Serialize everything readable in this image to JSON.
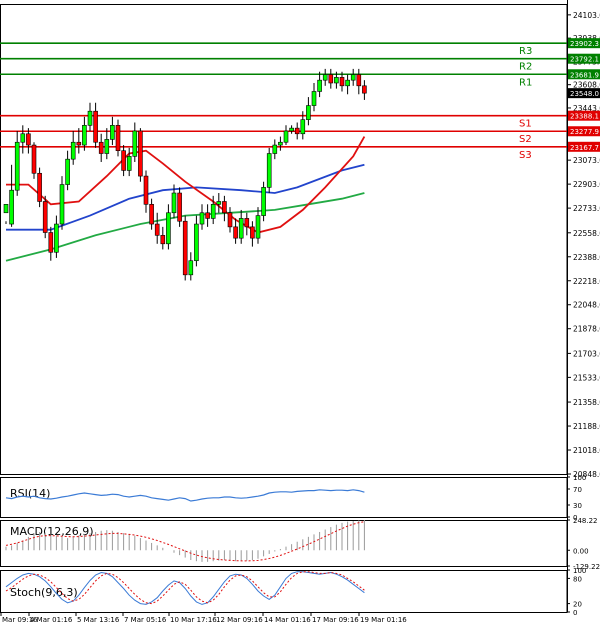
{
  "chart_data": [
    {
      "type": "candlestick",
      "panel": "price",
      "y_ticks": [
        "24103.0",
        "23938.0",
        "23773.0",
        "23608.0",
        "23443.0",
        "23278.0",
        "23073.0",
        "22903.0",
        "22733.0",
        "22558.0",
        "22388.0",
        "22218.0",
        "22048.0",
        "21878.0",
        "21703.0",
        "21533.0",
        "21358.0",
        "21188.0",
        "21018.0",
        "20848.0"
      ],
      "x_ticks": [
        "Mar 09:16",
        "4 Mar 01:16",
        "5 Mar 13:16",
        "7 Mar 05:16",
        "10 Mar 17:16",
        "12 Mar 09:16",
        "14 Mar 01:16",
        "17 Mar 09:16",
        "19 Mar 01:16"
      ],
      "ylim": [
        20848,
        24180
      ],
      "levels": [
        {
          "name": "R3",
          "value": 23902.3,
          "label": "23902.3",
          "color": "#008000"
        },
        {
          "name": "R2",
          "value": 23792.1,
          "label": "23792.1",
          "color": "#008000"
        },
        {
          "name": "R1",
          "value": 23681.9,
          "label": "23681.9",
          "color": "#008000"
        },
        {
          "name": "S1",
          "value": 23388.1,
          "label": "23388.1",
          "color": "#e00000"
        },
        {
          "name": "S2",
          "value": 23277.9,
          "label": "23277.9",
          "color": "#e00000"
        },
        {
          "name": "S3",
          "value": 23167.7,
          "label": "23167.7",
          "color": "#e00000"
        }
      ],
      "current_price": {
        "value": 23548.0,
        "label": "23548.0"
      },
      "candles": [
        [
          22700,
          22760,
          22640,
          22620
        ],
        [
          22620,
          22860,
          23040,
          22600
        ],
        [
          22860,
          23200,
          23280,
          22820
        ],
        [
          23200,
          23260,
          23320,
          23120
        ],
        [
          23260,
          23180,
          23300,
          23120
        ],
        [
          23180,
          22980,
          23200,
          22940
        ],
        [
          22980,
          22780,
          23020,
          22740
        ],
        [
          22780,
          22560,
          22820,
          22520
        ],
        [
          22560,
          22420,
          22600,
          22360
        ],
        [
          22420,
          22620,
          22680,
          22380
        ],
        [
          22620,
          22900,
          22960,
          22580
        ],
        [
          22900,
          23080,
          23140,
          22860
        ],
        [
          23080,
          23200,
          23280,
          23040
        ],
        [
          23200,
          23180,
          23300,
          23120
        ],
        [
          23180,
          23320,
          23380,
          23140
        ],
        [
          23320,
          23420,
          23480,
          23280
        ],
        [
          23420,
          23200,
          23480,
          23160
        ],
        [
          23200,
          23120,
          23260,
          23060
        ],
        [
          23120,
          23220,
          23300,
          23080
        ],
        [
          23220,
          23320,
          23380,
          23180
        ],
        [
          23320,
          23140,
          23360,
          23100
        ],
        [
          23140,
          23000,
          23180,
          22960
        ],
        [
          23000,
          23100,
          23160,
          22960
        ],
        [
          23100,
          23280,
          23340,
          23060
        ],
        [
          23280,
          22960,
          23300,
          22920
        ],
        [
          22960,
          22760,
          23000,
          22700
        ],
        [
          22760,
          22620,
          22800,
          22580
        ],
        [
          22620,
          22540,
          22700,
          22480
        ],
        [
          22540,
          22480,
          22600,
          22440
        ],
        [
          22480,
          22700,
          22760,
          22440
        ],
        [
          22700,
          22840,
          22900,
          22660
        ],
        [
          22840,
          22640,
          22880,
          22600
        ],
        [
          22640,
          22260,
          22680,
          22220
        ],
        [
          22260,
          22360,
          22420,
          22220
        ],
        [
          22360,
          22620,
          22680,
          22320
        ],
        [
          22620,
          22700,
          22760,
          22580
        ],
        [
          22700,
          22660,
          22760,
          22600
        ],
        [
          22660,
          22760,
          22820,
          22620
        ],
        [
          22760,
          22780,
          22840,
          22700
        ],
        [
          22780,
          22700,
          22820,
          22640
        ],
        [
          22700,
          22600,
          22740,
          22560
        ],
        [
          22600,
          22520,
          22660,
          22480
        ],
        [
          22520,
          22660,
          22720,
          22480
        ],
        [
          22660,
          22600,
          22700,
          22540
        ],
        [
          22600,
          22520,
          22640,
          22460
        ],
        [
          22520,
          22680,
          22740,
          22480
        ],
        [
          22680,
          22880,
          22920,
          22640
        ],
        [
          22880,
          23120,
          23160,
          22840
        ],
        [
          23120,
          23180,
          23220,
          23080
        ],
        [
          23180,
          23200,
          23240,
          23140
        ],
        [
          23200,
          23280,
          23320,
          23180
        ],
        [
          23280,
          23300,
          23320,
          23260
        ],
        [
          23300,
          23260,
          23340,
          23220
        ],
        [
          23260,
          23360,
          23420,
          23220
        ],
        [
          23360,
          23460,
          23520,
          23320
        ],
        [
          23460,
          23560,
          23620,
          23420
        ],
        [
          23560,
          23640,
          23700,
          23520
        ],
        [
          23640,
          23680,
          23720,
          23600
        ],
        [
          23680,
          23620,
          23720,
          23580
        ],
        [
          23620,
          23660,
          23700,
          23580
        ],
        [
          23660,
          23600,
          23700,
          23560
        ],
        [
          23600,
          23640,
          23680,
          23540
        ],
        [
          23640,
          23680,
          23720,
          23600
        ],
        [
          23680,
          23600,
          23720,
          23540
        ],
        [
          23600,
          23548,
          23640,
          23500
        ]
      ],
      "ma_fast": [
        [
          0,
          22900
        ],
        [
          4,
          22900
        ],
        [
          8,
          22760
        ],
        [
          13,
          22780
        ],
        [
          18,
          22960
        ],
        [
          22,
          23120
        ],
        [
          25,
          23140
        ],
        [
          28,
          23050
        ],
        [
          32,
          22920
        ],
        [
          37,
          22780
        ],
        [
          41,
          22650
        ],
        [
          45,
          22560
        ],
        [
          49,
          22600
        ],
        [
          53,
          22720
        ],
        [
          57,
          22880
        ],
        [
          62,
          23100
        ],
        [
          64,
          23240
        ]
      ],
      "ma_mid": [
        [
          0,
          22580
        ],
        [
          8,
          22580
        ],
        [
          15,
          22680
        ],
        [
          22,
          22800
        ],
        [
          28,
          22860
        ],
        [
          34,
          22880
        ],
        [
          42,
          22860
        ],
        [
          48,
          22840
        ],
        [
          52,
          22880
        ],
        [
          56,
          22940
        ],
        [
          60,
          23000
        ],
        [
          64,
          23040
        ]
      ],
      "ma_slow": [
        [
          0,
          22360
        ],
        [
          8,
          22440
        ],
        [
          16,
          22540
        ],
        [
          24,
          22620
        ],
        [
          32,
          22680
        ],
        [
          40,
          22700
        ],
        [
          48,
          22720
        ],
        [
          54,
          22760
        ],
        [
          60,
          22800
        ],
        [
          64,
          22840
        ]
      ]
    },
    {
      "type": "line",
      "panel": "rsi",
      "title": "RSI(14)",
      "y_ticks": [
        "100",
        "70",
        "30",
        "0"
      ],
      "ylim": [
        0,
        100
      ],
      "values": [
        48,
        46,
        50,
        52,
        50,
        52,
        48,
        46,
        45,
        47,
        50,
        52,
        55,
        58,
        60,
        58,
        56,
        54,
        55,
        57,
        56,
        52,
        50,
        52,
        54,
        52,
        48,
        46,
        44,
        42,
        45,
        48,
        46,
        40,
        42,
        45,
        47,
        48,
        48,
        50,
        50,
        48,
        47,
        48,
        50,
        52,
        55,
        60,
        62,
        63,
        63,
        62,
        64,
        65,
        66,
        66,
        68,
        67,
        66,
        67,
        67,
        66,
        68,
        66,
        62
      ]
    },
    {
      "type": "bar",
      "panel": "macd",
      "title": "MACD(12,26,9)",
      "y_ticks": [
        "248.22",
        "0.00",
        "-129.22"
      ],
      "ylim": [
        -129.22,
        248.22
      ],
      "histogram": [
        30,
        40,
        60,
        80,
        110,
        140,
        150,
        145,
        130,
        120,
        110,
        100,
        110,
        120,
        130,
        140,
        150,
        160,
        165,
        160,
        150,
        140,
        130,
        120,
        100,
        80,
        60,
        40,
        20,
        0,
        -20,
        -40,
        -60,
        -80,
        -90,
        -95,
        -95,
        -90,
        -85,
        -80,
        -85,
        -90,
        -88,
        -85,
        -80,
        -70,
        -50,
        -30,
        -10,
        10,
        30,
        50,
        70,
        90,
        110,
        130,
        150,
        170,
        190,
        210,
        225,
        235,
        240,
        245,
        248
      ],
      "signal": [
        40,
        50,
        60,
        75,
        90,
        105,
        115,
        120,
        120,
        118,
        115,
        112,
        110,
        112,
        116,
        120,
        125,
        130,
        135,
        138,
        138,
        135,
        130,
        124,
        116,
        106,
        94,
        80,
        64,
        48,
        30,
        12,
        -6,
        -24,
        -40,
        -52,
        -62,
        -70,
        -76,
        -80,
        -83,
        -86,
        -87,
        -87,
        -86,
        -83,
        -77,
        -68,
        -56,
        -42,
        -26,
        -8,
        10,
        30,
        50,
        70,
        92,
        114,
        136,
        158,
        178,
        198,
        214,
        226,
        235
      ]
    },
    {
      "type": "line",
      "panel": "stoch",
      "title": "Stoch(9,6,3)",
      "y_ticks": [
        "100",
        "80",
        "20",
        "0"
      ],
      "ylim": [
        0,
        100
      ],
      "main": [
        60,
        70,
        80,
        88,
        92,
        90,
        84,
        74,
        60,
        44,
        30,
        22,
        26,
        40,
        58,
        75,
        88,
        94,
        92,
        84,
        70,
        56,
        40,
        28,
        20,
        18,
        24,
        34,
        50,
        64,
        74,
        70,
        56,
        38,
        24,
        18,
        22,
        36,
        54,
        72,
        86,
        90,
        88,
        80,
        66,
        50,
        38,
        30,
        40,
        60,
        80,
        92,
        96,
        96,
        94,
        92,
        90,
        92,
        94,
        90,
        84,
        76,
        66,
        56,
        46
      ],
      "signal": [
        50,
        58,
        68,
        78,
        86,
        90,
        88,
        82,
        72,
        58,
        44,
        32,
        26,
        30,
        42,
        58,
        74,
        86,
        92,
        90,
        82,
        70,
        56,
        42,
        30,
        22,
        20,
        26,
        38,
        52,
        66,
        72,
        66,
        52,
        36,
        26,
        22,
        28,
        42,
        60,
        76,
        86,
        88,
        84,
        74,
        60,
        46,
        36,
        36,
        48,
        66,
        82,
        92,
        96,
        96,
        94,
        92,
        92,
        94,
        92,
        88,
        80,
        72,
        62,
        52
      ]
    }
  ]
}
